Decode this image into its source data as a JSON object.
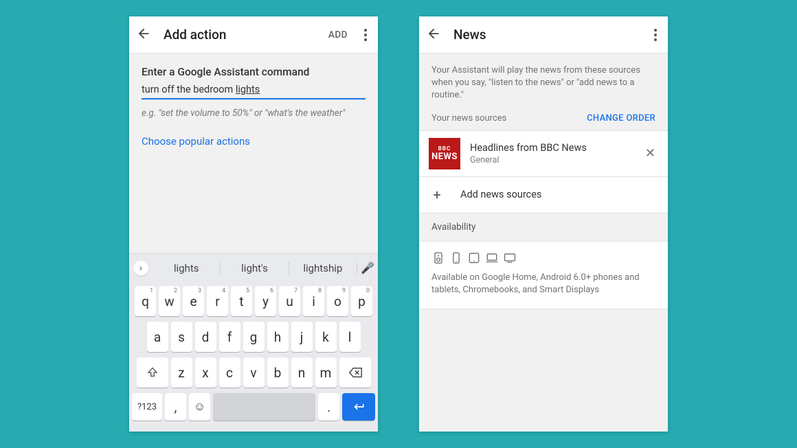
{
  "left": {
    "title": "Add action",
    "add_label": "ADD",
    "heading": "Enter a Google Assistant command",
    "command_prefix": "turn off the bedroom ",
    "command_underlined": "lights",
    "example": "e.g. \"set the volume to 50%\" or \"what's the weather\"",
    "popular_link": "Choose popular actions",
    "suggestions": [
      "lights",
      "light's",
      "lightship"
    ],
    "keyboard": {
      "row1": [
        {
          "k": "q",
          "d": "1"
        },
        {
          "k": "w",
          "d": "2"
        },
        {
          "k": "e",
          "d": "3"
        },
        {
          "k": "r",
          "d": "4"
        },
        {
          "k": "t",
          "d": "5"
        },
        {
          "k": "y",
          "d": "6"
        },
        {
          "k": "u",
          "d": "7"
        },
        {
          "k": "i",
          "d": "8"
        },
        {
          "k": "o",
          "d": "9"
        },
        {
          "k": "p",
          "d": "0"
        }
      ],
      "row2": [
        "a",
        "s",
        "d",
        "f",
        "g",
        "h",
        "j",
        "k",
        "l"
      ],
      "row3": [
        "z",
        "x",
        "c",
        "v",
        "b",
        "n",
        "m"
      ],
      "switch": "?123"
    }
  },
  "right": {
    "title": "News",
    "description": "Your Assistant will play the news from these sources when you say, \"listen to the news\" or \"add news to a routine.\"",
    "sources_label": "Your news sources",
    "change_order": "CHANGE ORDER",
    "source": {
      "logo_top": "BBC",
      "logo_bottom": "NEWS",
      "name": "Headlines from BBC News",
      "category": "General"
    },
    "add_sources": "Add news sources",
    "availability_label": "Availability",
    "availability_text": "Available on Google Home, Android 6.0+ phones and tablets, Chromebooks, and Smart Displays"
  }
}
